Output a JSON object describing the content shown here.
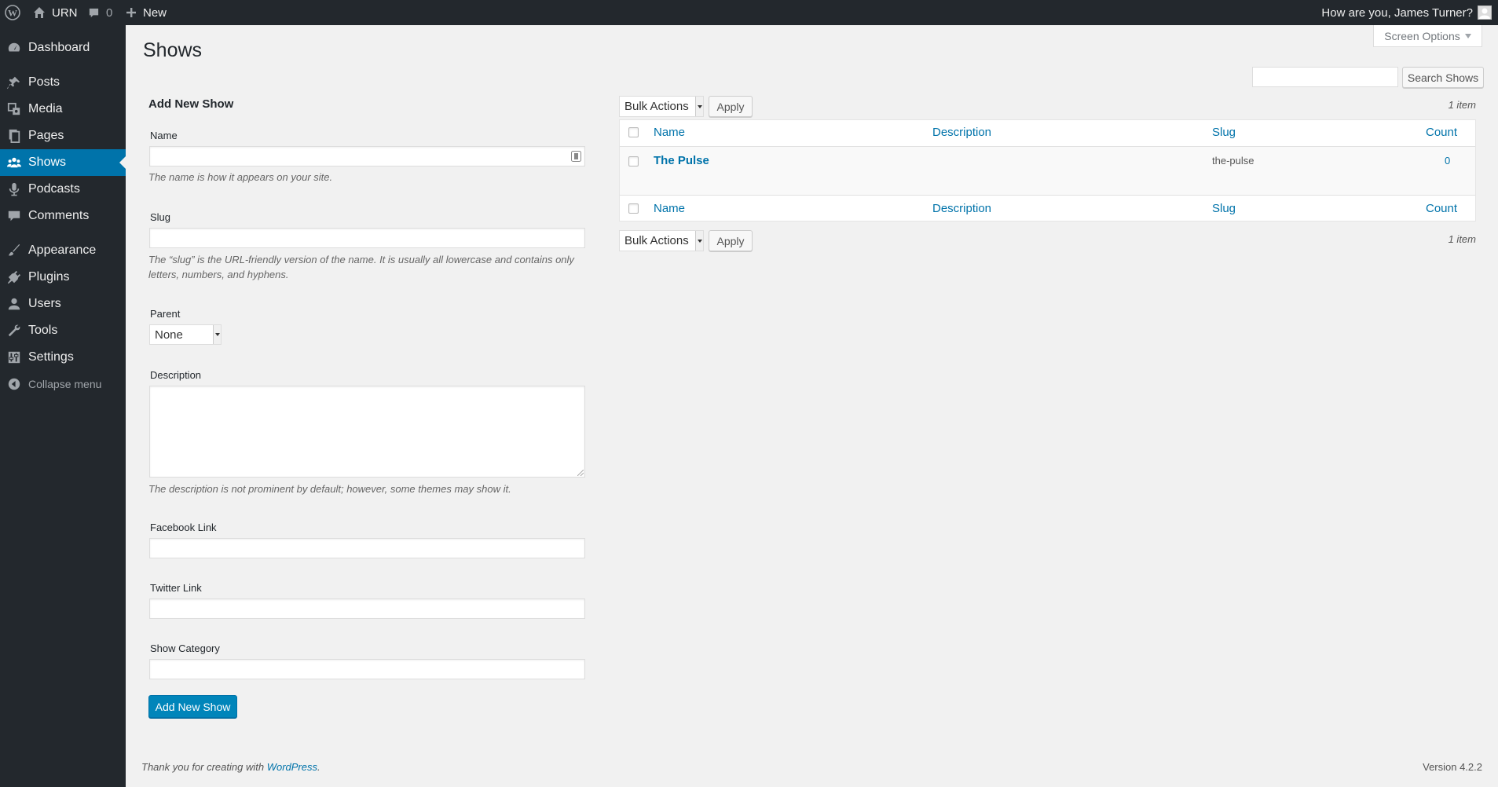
{
  "adminbar": {
    "site_name": "URN",
    "comment_count": "0",
    "new_label": "New",
    "greeting": "How are you, James Turner?"
  },
  "sidebar": {
    "items": [
      {
        "label": "Dashboard",
        "icon": "dashboard-icon"
      },
      {
        "label": "Posts",
        "icon": "pushpin-icon"
      },
      {
        "label": "Media",
        "icon": "media-icon"
      },
      {
        "label": "Pages",
        "icon": "pages-icon"
      },
      {
        "label": "Shows",
        "icon": "groups-icon",
        "current": true
      },
      {
        "label": "Podcasts",
        "icon": "microphone-icon"
      },
      {
        "label": "Comments",
        "icon": "comment-icon"
      },
      {
        "label": "Appearance",
        "icon": "brush-icon"
      },
      {
        "label": "Plugins",
        "icon": "plugin-icon"
      },
      {
        "label": "Users",
        "icon": "user-icon"
      },
      {
        "label": "Tools",
        "icon": "wrench-icon"
      },
      {
        "label": "Settings",
        "icon": "settings-icon"
      }
    ],
    "collapse_label": "Collapse menu"
  },
  "page": {
    "title": "Shows",
    "screen_options": "Screen Options",
    "search_button": "Search Shows",
    "search_value": ""
  },
  "form": {
    "title": "Add New Show",
    "name_label": "Name",
    "name_help": "The name is how it appears on your site.",
    "slug_label": "Slug",
    "slug_help": "The “slug” is the URL-friendly version of the name. It is usually all lowercase and contains only letters, numbers, and hyphens.",
    "parent_label": "Parent",
    "parent_value": "None",
    "description_label": "Description",
    "description_help": "The description is not prominent by default; however, some themes may show it.",
    "facebook_label": "Facebook Link",
    "twitter_label": "Twitter Link",
    "category_label": "Show Category",
    "submit_label": "Add New Show"
  },
  "table": {
    "bulk_actions": "Bulk Actions",
    "apply": "Apply",
    "items_count": "1 item",
    "columns": [
      "Name",
      "Description",
      "Slug",
      "Count"
    ],
    "rows": [
      {
        "name": "The Pulse",
        "description": "",
        "slug": "the-pulse",
        "count": "0"
      }
    ]
  },
  "footer": {
    "thanks_prefix": "Thank you for creating with ",
    "wordpress_link": "WordPress",
    "thanks_suffix": ".",
    "version": "Version 4.2.2"
  },
  "colors": {
    "adminbar_bg": "#23282d",
    "accent": "#0073aa",
    "primary_button": "#0085ba",
    "page_bg": "#f1f1f1"
  }
}
